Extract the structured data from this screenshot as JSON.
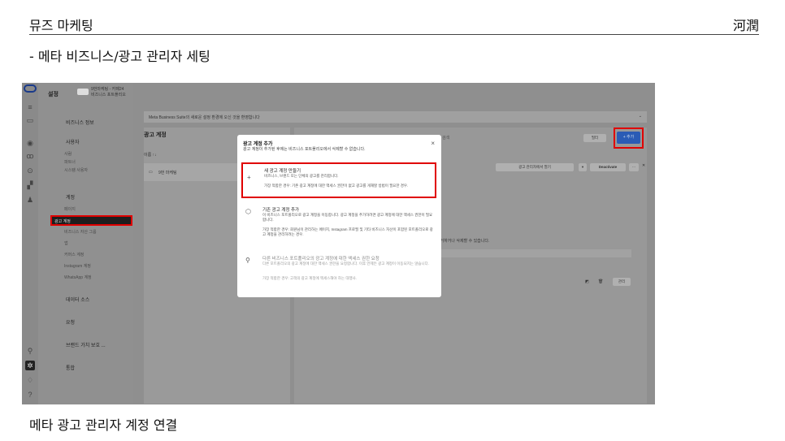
{
  "header": {
    "title": "뮤즈 마케팅",
    "brand": "河潤"
  },
  "subtitle": "-  메타 비즈니스/광고 관리자 세팅",
  "caption": "메타 광고 관리자 계정 연결",
  "screenshot": {
    "settings_title": "설정",
    "account_name": "9번마케팅 - 카페24",
    "account_type": "비즈니스 포트폴리오",
    "banner": "Meta Business Suite의 새로운 설정 환경에 오신 것을 환영합니다",
    "section_title": "광고 계정",
    "count_label": "이름 ↑↓",
    "list_item": "9번 마케팅",
    "search_placeholder": "이름 또는 ID로 검색",
    "filter_label": "필터",
    "add_label": "+ 추가",
    "open_manager": "광고 관리자에서 열기",
    "deactivate": "Deactivate",
    "remove_note": "제거하거나 삭제할 수 있습니다.",
    "manage": "관리",
    "nav": [
      {
        "label": "비즈니스 정보",
        "kind": "hdr"
      },
      {
        "label": "사용자",
        "kind": "hdr"
      },
      {
        "label": "사람",
        "kind": "sub"
      },
      {
        "label": "파트너",
        "kind": "sub"
      },
      {
        "label": "시스템 사용자",
        "kind": "sub"
      },
      {
        "label": "계정",
        "kind": "hdr"
      },
      {
        "label": "페이지",
        "kind": "sub"
      },
      {
        "label": "광고 계정",
        "kind": "active"
      },
      {
        "label": "비즈니스 자산 그룹",
        "kind": "sub"
      },
      {
        "label": "앱",
        "kind": "sub"
      },
      {
        "label": "커머스 계정",
        "kind": "sub"
      },
      {
        "label": "Instagram 계정",
        "kind": "sub"
      },
      {
        "label": "WhatsApp 계정",
        "kind": "sub"
      },
      {
        "label": "데이터 소스",
        "kind": "hdr"
      },
      {
        "label": "요청",
        "kind": "hdr"
      },
      {
        "label": "브랜드 가치 보호 ...",
        "kind": "hdr"
      },
      {
        "label": "통합",
        "kind": "hdr"
      }
    ],
    "modal": {
      "title": "광고 계정 추가",
      "subtitle": "광고 계정이 추가된 후에는 비즈니스 포트폴리오에서 삭제할 수 없습니다.",
      "close": "×",
      "options": [
        {
          "title": "새 광고 계정 만들기",
          "desc1": "비즈니스, 브랜드 또는 단체의 광고를 관리합니다.",
          "desc2": "가장 적합한 경우: 기존 광고 계정에 대한 액세스 권한이 없고 광고를 게재할 방법이 필요한 경우.",
          "icon": "+"
        },
        {
          "title": "기존 광고 계정 추가",
          "desc1": "이 비즈니스 포트폴리오로 광고 계정을 이동합니다. 광고 계정을 추가하려면 광고 계정에 대한 액세스 권한이 필요합니다.",
          "desc2": "가장 적합한 경우: 회원님이 관리하는 페이지, Instagram 프로필 및 기타 비즈니스 자산이 포함된 포트폴리오로 광고 계정을 관리하려는 경우.",
          "icon": "⬡"
        },
        {
          "title": "다른 비즈니스 포트폴리오의 광고 계정에 대한 액세스 권한 요청",
          "desc1": "다른 포트폴리오의 광고 계정에 대한 액세스 권한을 요청합니다. 이후 언제든 광고 계정이 이동되지는 않습니다.",
          "desc2": "가장 적합한 경우: 고객의 광고 계정에 액세스해야 하는 대행사.",
          "icon": "⚲"
        }
      ]
    }
  }
}
